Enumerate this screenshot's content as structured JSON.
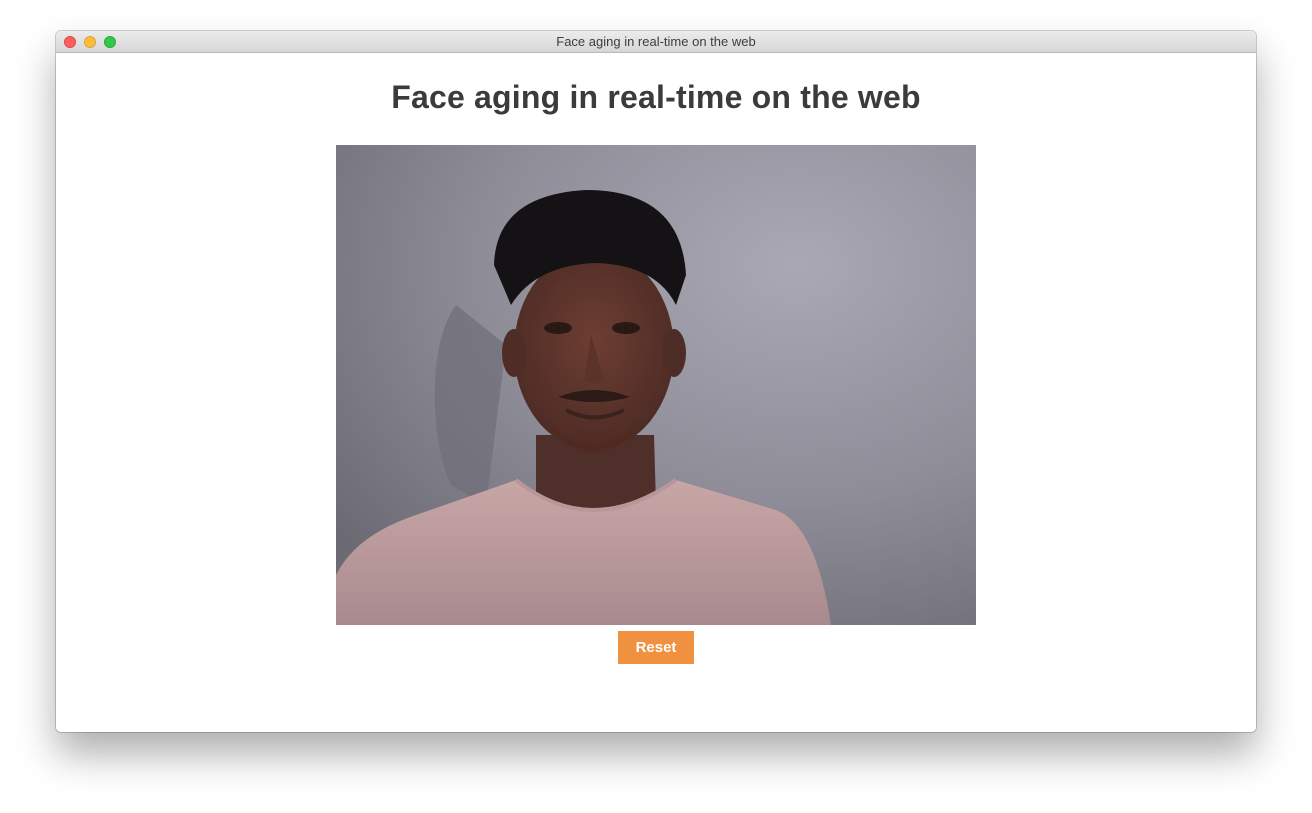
{
  "window": {
    "title": "Face aging in real-time on the web"
  },
  "page": {
    "heading": "Face aging in real-time on the web"
  },
  "video": {
    "icon": "webcam-video-feed"
  },
  "controls": {
    "reset_label": "Reset",
    "reset_color": "#f0913f"
  }
}
